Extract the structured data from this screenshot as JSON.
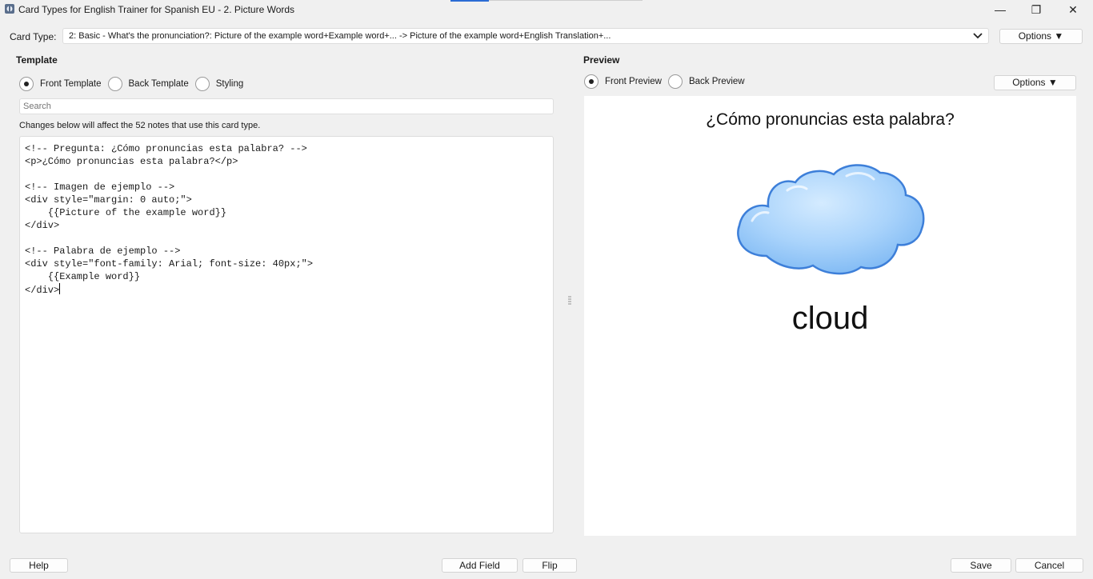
{
  "window": {
    "title": "Card Types for English Trainer for Spanish EU - 2. Picture Words",
    "minimize_glyph": "—",
    "maximize_glyph": "❐",
    "close_glyph": "✕"
  },
  "card_type": {
    "label": "Card Type:",
    "value": "2: Basic - What's the pronunciation?: Picture of the example word+Example word+... -> Picture of the example word+English Translation+...",
    "options_label": "Options ▼"
  },
  "template": {
    "title": "Template",
    "radios": [
      {
        "label": "Front Template",
        "checked": true
      },
      {
        "label": "Back Template",
        "checked": false
      },
      {
        "label": "Styling",
        "checked": false
      }
    ],
    "search_placeholder": "Search",
    "changes_note": "Changes below will affect the 52 notes that use this card type.",
    "code_lines": [
      "<!-- Pregunta: ¿Cómo pronuncias esta palabra? -->",
      "<p>¿Cómo pronuncias esta palabra?</p>",
      "",
      "<!-- Imagen de ejemplo -->",
      "<div style=\"margin: 0 auto;\">",
      "    {{Picture of the example word}}",
      "</div>",
      "",
      "<!-- Palabra de ejemplo -->",
      "<div style=\"font-family: Arial; font-size: 40px;\">",
      "    {{Example word}}",
      "</div>"
    ]
  },
  "preview": {
    "title": "Preview",
    "radios": [
      {
        "label": "Front Preview",
        "checked": true
      },
      {
        "label": "Back Preview",
        "checked": false
      }
    ],
    "options_label": "Options ▼",
    "question": "¿Cómo pronuncias esta palabra?",
    "image_icon": "cloud-picture",
    "word": "cloud"
  },
  "footer": {
    "help": "Help",
    "add_field": "Add Field",
    "flip": "Flip",
    "save": "Save",
    "cancel": "Cancel"
  }
}
